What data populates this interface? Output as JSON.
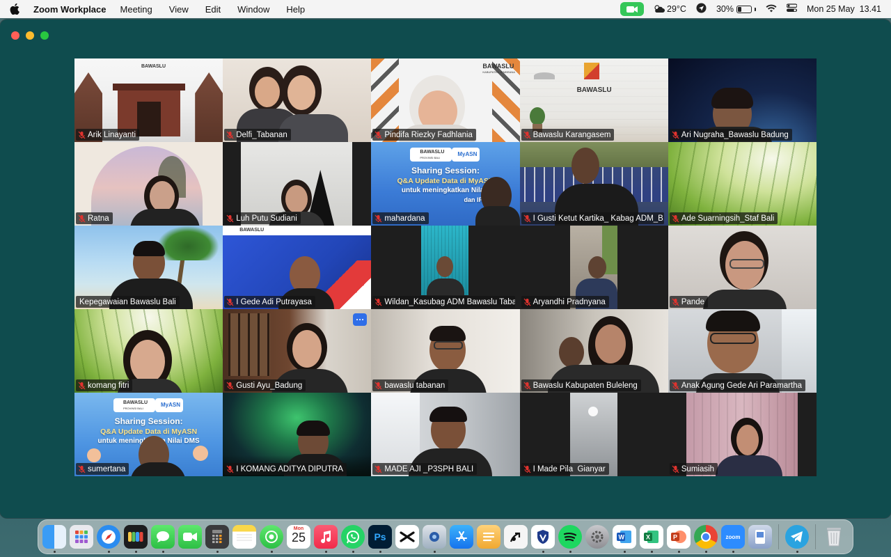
{
  "menubar": {
    "app_name": "Zoom Workplace",
    "menus": [
      "Meeting",
      "View",
      "Edit",
      "Window",
      "Help"
    ],
    "weather": "29°C",
    "battery": "30%",
    "battery_level": 0.3,
    "datetime": "Mon 25 May  13.41"
  },
  "tiles": [
    {
      "name": "Arik Linayanti"
    },
    {
      "name": "Delfi_Tabanan"
    },
    {
      "name": "Pindifa Riezky Fadhlania"
    },
    {
      "name": "Bawaslu Karangasem"
    },
    {
      "name": "Ari Nugraha_Bawaslu Badung"
    },
    {
      "name": "Ratna"
    },
    {
      "name": "Luh Putu Sudiani"
    },
    {
      "name": "mahardana"
    },
    {
      "name": "I Gusti Ketut Kartika_ Kabag ADM_B..."
    },
    {
      "name": "Ade Suarningsih_Staf Bali"
    },
    {
      "name": "Kepegawaian Bawaslu Bali"
    },
    {
      "name": "I Gede Adi Putrayasa"
    },
    {
      "name": "Wildan_Kasubag ADM Bawaslu Taba..."
    },
    {
      "name": "Aryandhi Pradnyana"
    },
    {
      "name": "Pande"
    },
    {
      "name": "komang fitri"
    },
    {
      "name": "Gusti Ayu_Badung"
    },
    {
      "name": "bawaslu tabanan"
    },
    {
      "name": "Bawaslu Kabupaten Buleleng"
    },
    {
      "name": "Anak Agung Gede Ari Paramartha"
    },
    {
      "name": "sumertana"
    },
    {
      "name": "I KOMANG ADITYA DIPUTRA"
    },
    {
      "name": "MADE AJI _P3SPH BALI"
    },
    {
      "name": "I Made Pila  Gianyar"
    },
    {
      "name": "Sumiasih"
    }
  ],
  "branding": {
    "bawaslu": "BAWASLU",
    "kab_jembrana": "KABUPATEN JEMBRANA",
    "slide_line1": "Sharing Session:",
    "slide_line2": "Q&A Update Data di MyASN",
    "slide_line3": "untuk meningkatkan Nilai DMS",
    "slide_line4": "dan IP",
    "myasn": "MyASN",
    "provinsi_bali": "PROVINSI BALI"
  },
  "dock": {
    "calendar_month": "Mon",
    "calendar_day": "25"
  },
  "colors": {
    "window_bg": "#0f4c4e",
    "active_speaker": "#3bd16f",
    "mute_red": "#e0332e"
  }
}
